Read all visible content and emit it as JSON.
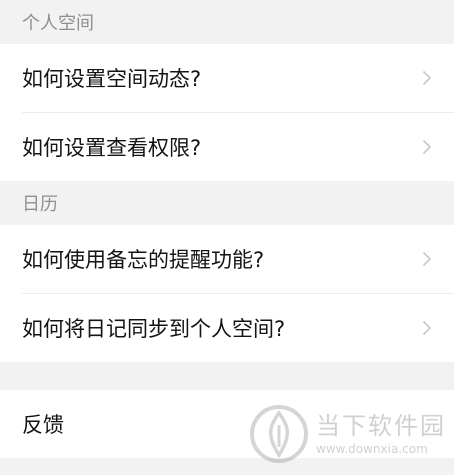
{
  "sections": [
    {
      "header": "个人空间",
      "items": [
        {
          "label": "如何设置空间动态?"
        },
        {
          "label": "如何设置查看权限?"
        }
      ]
    },
    {
      "header": "日历",
      "items": [
        {
          "label": "如何使用备忘的提醒功能?"
        },
        {
          "label": "如何将日记同步到个人空间?"
        }
      ]
    }
  ],
  "feedback": {
    "label": "反馈"
  },
  "watermark": {
    "name": "当下软件园",
    "url": "www.downxia.com"
  },
  "icons": {
    "row_chevron": "chevron-right-icon"
  },
  "colors": {
    "background": "#f2f2f2",
    "row_background": "#ffffff",
    "header_text": "#8f8f8f",
    "row_text": "#141414",
    "chevron": "#c7c7c7"
  }
}
